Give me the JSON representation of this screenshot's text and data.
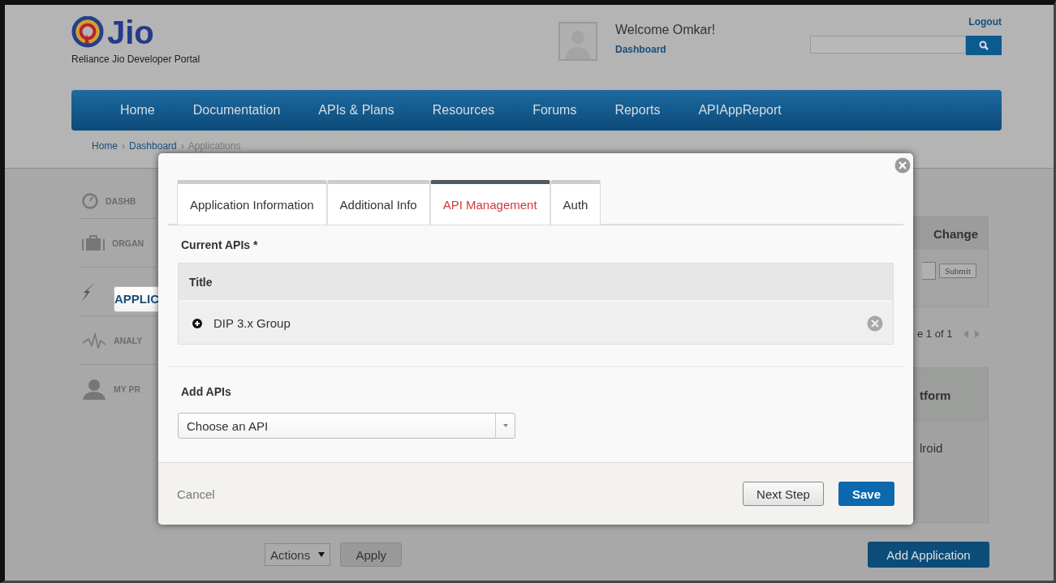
{
  "header": {
    "logo_text": "Jio",
    "tagline": "Reliance Jio Developer Portal",
    "welcome": "Welcome Omkar!",
    "dashboard_link": "Dashboard",
    "logout": "Logout"
  },
  "nav": [
    "Home",
    "Documentation",
    "APIs & Plans",
    "Resources",
    "Forums",
    "Reports",
    "APIAppReport"
  ],
  "breadcrumb": [
    "Home",
    "Dashboard",
    "Applications"
  ],
  "breadcrumb_separator": "›",
  "sidebar": [
    {
      "kind": "dashboard",
      "label": "DASHB",
      "selected": false
    },
    {
      "kind": "organization",
      "label": "ORGAN",
      "selected": false
    },
    {
      "kind": "applications",
      "label": "APPLIC",
      "selected": true
    },
    {
      "kind": "analytics",
      "label": "ANALY",
      "selected": false
    },
    {
      "kind": "profile",
      "label": "MY PR",
      "selected": false
    }
  ],
  "change_panel": {
    "title": "Change",
    "button": "Submit"
  },
  "pager": "e 1 of 1",
  "platform_table": {
    "header": "tform",
    "cell": "lroid"
  },
  "bulk_actions": {
    "select": "Actions",
    "apply": "Apply"
  },
  "add_button": "Add Application",
  "modal": {
    "tabs": [
      {
        "label": "Application Information",
        "selected": false
      },
      {
        "label": "Additional Info",
        "selected": false
      },
      {
        "label": "API Management",
        "selected": true
      },
      {
        "label": "Auth",
        "selected": false
      }
    ],
    "current_label": "Current APIs *",
    "table_header": "Title",
    "rows": [
      {
        "name": "DIP 3.x Group"
      }
    ],
    "add_label": "Add APIs",
    "select_placeholder": "Choose an API",
    "cancel": "Cancel",
    "next": "Next Step",
    "save": "Save"
  }
}
